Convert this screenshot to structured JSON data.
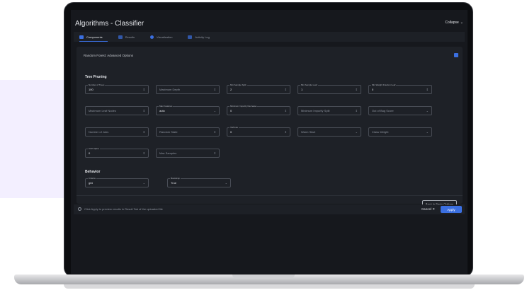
{
  "app": {
    "title": "Algorithms - Classifier",
    "collapse_label": "Collapse"
  },
  "tabs": [
    {
      "label": "Components",
      "active": true
    },
    {
      "label": "Results",
      "active": false
    },
    {
      "label": "Visualization",
      "active": false
    },
    {
      "label": "Activity Log",
      "active": false
    }
  ],
  "panel": {
    "heading": "Random Forest: Advanced Options"
  },
  "tree_pruning": {
    "title": "Tree Pruning",
    "fields": [
      {
        "label": "Number of Trees",
        "value": "100",
        "kind": "stepper"
      },
      {
        "label": "",
        "placeholder": "Maximum Depth",
        "kind": "stepper"
      },
      {
        "label": "Min Sample Split",
        "value": "2",
        "kind": "stepper"
      },
      {
        "label": "Min Sample Leaf",
        "value": "1",
        "kind": "stepper"
      },
      {
        "label": "Min Weight Fraction Leaf",
        "value": "0",
        "kind": "stepper"
      },
      {
        "label": "",
        "placeholder": "Maximum Leaf Nodes",
        "kind": "stepper"
      },
      {
        "label": "Max Features",
        "value": "auto",
        "kind": "select"
      },
      {
        "label": "Minimum Impurity Decrease",
        "value": "0",
        "kind": "stepper"
      },
      {
        "label": "",
        "placeholder": "Minimum Impurity Split",
        "kind": "stepper"
      },
      {
        "label": "",
        "placeholder": "Out of Bag Score",
        "kind": "select"
      },
      {
        "label": "",
        "placeholder": "Number of Jobs",
        "kind": "stepper"
      },
      {
        "label": "",
        "placeholder": "Random State",
        "kind": "stepper"
      },
      {
        "label": "Verbose",
        "value": "0",
        "kind": "stepper"
      },
      {
        "label": "",
        "placeholder": "Warm Start",
        "kind": "select"
      },
      {
        "label": "",
        "placeholder": "Class Weight",
        "kind": "select"
      },
      {
        "label": "CCP Alpha",
        "value": "0",
        "kind": "stepper"
      },
      {
        "label": "",
        "placeholder": "Max Samples",
        "kind": "stepper"
      }
    ]
  },
  "behavior": {
    "title": "Behavior",
    "fields": [
      {
        "label": "Criteria",
        "value": "gini",
        "kind": "select"
      },
      {
        "label": "Bootstrap",
        "value": "True",
        "kind": "select"
      }
    ]
  },
  "buttons": {
    "back_basic": "Back to Basic Options",
    "cancel": "Cancel",
    "apply": "Apply"
  },
  "footer": {
    "info": "Click Apply to preview results in Result Tab of the uploaded file"
  },
  "colors": {
    "accent": "#3b6fe0",
    "background": "#16181d",
    "panel": "#1e2127"
  }
}
